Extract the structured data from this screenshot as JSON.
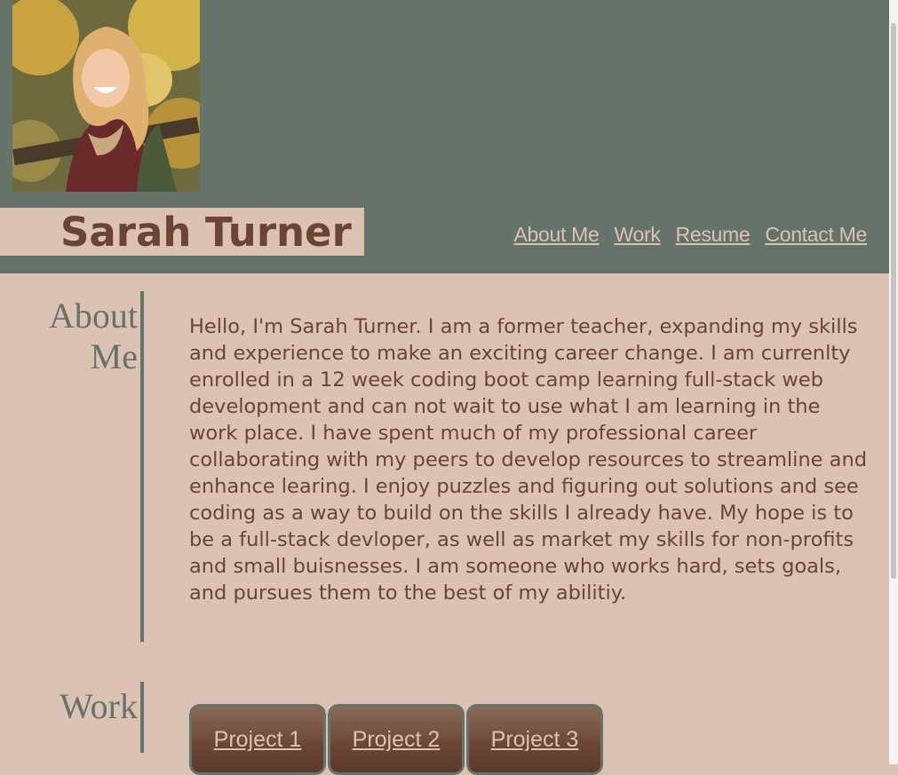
{
  "header": {
    "photo_alt": "portrait photo",
    "name": "Sarah Turner",
    "nav": [
      "About Me",
      "Work",
      "Resume",
      "Contact Me"
    ]
  },
  "about": {
    "title_line1": "About",
    "title_line2": "Me",
    "text": "Hello, I'm Sarah Turner. I am a former teacher, expanding my skills and experience to make an exciting career change. I am currenlty enrolled in a 12 week coding boot camp learning full-stack web development and can not wait to use what I am learning in the work place. I have spent much of my professional career collaborating with my peers to develop resources to streamline and enhance learing. I enjoy puzzles and figuring out solutions and see coding as a way to build on the skills I already have. My hope is to be a full-stack devloper, as well as market my skills for non-profits and small buisnesses. I am someone who works hard, sets goals, and pursues them to the best of my abilitiy."
  },
  "work": {
    "title": "Work",
    "projects": [
      "Project 1",
      "Project 2",
      "Project 3"
    ]
  },
  "colors": {
    "header_bg": "#65736a",
    "page_bg": "#dbc2b3",
    "text_brown": "#6a4535"
  }
}
